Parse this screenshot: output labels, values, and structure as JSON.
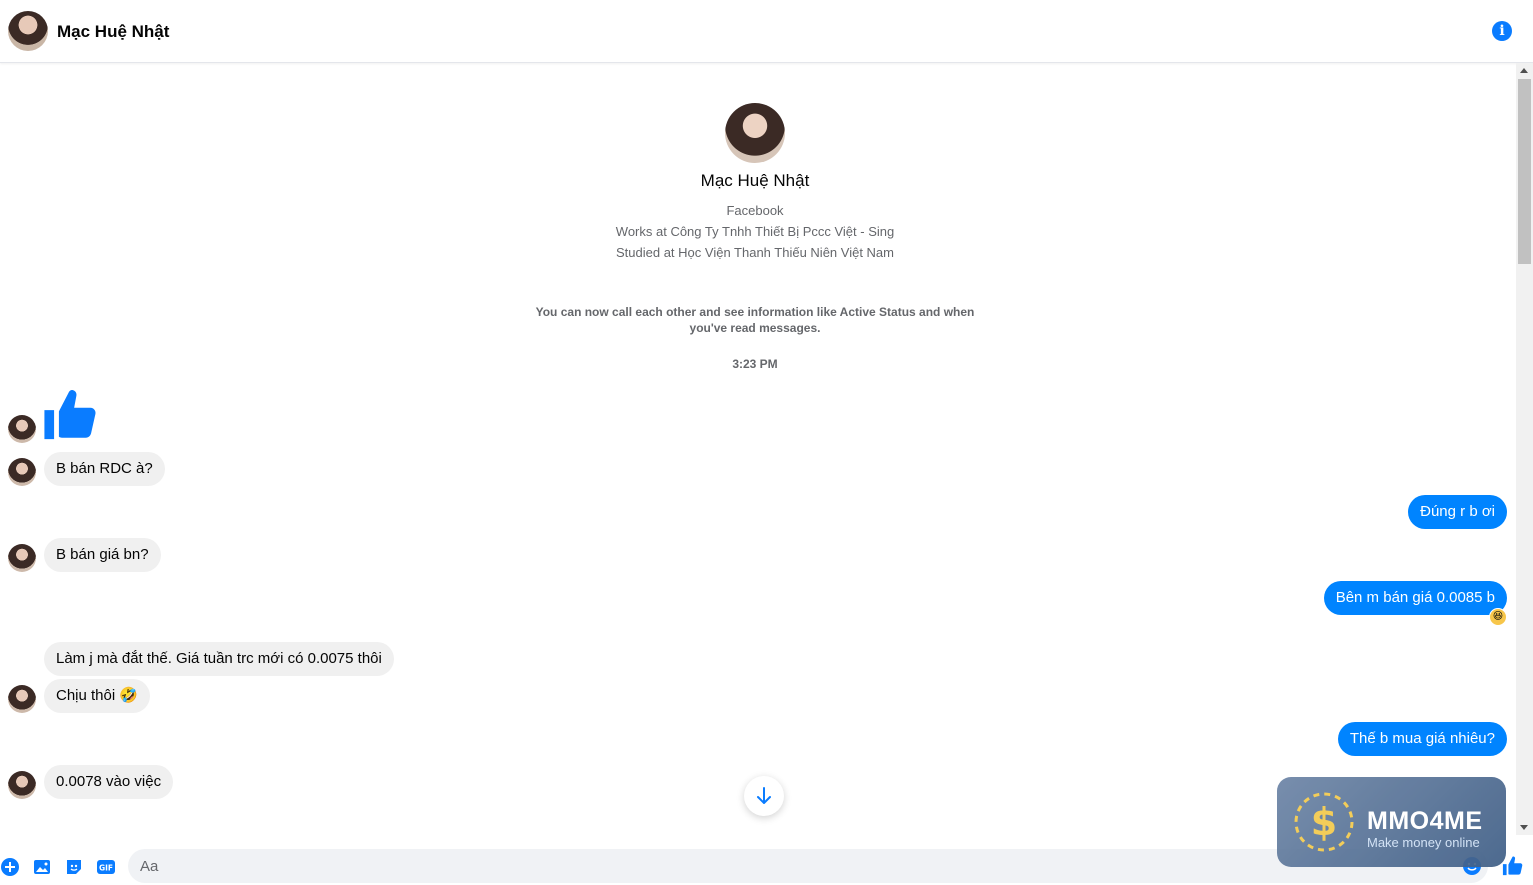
{
  "header": {
    "contact_name": "Mạc Huệ Nhật"
  },
  "profile": {
    "name": "Mạc Huệ Nhật",
    "platform": "Facebook",
    "work": "Works at Công Ty Tnhh Thiết Bị Pccc Việt - Sing",
    "education": "Studied at Học Viện Thanh Thiếu Niên Việt Nam"
  },
  "notice": "You can now call each other and see information like Active Status and when you've read messages.",
  "timestamp": "3:23 PM",
  "messages": [
    {
      "from": "them",
      "type": "like-sticker"
    },
    {
      "from": "them",
      "text": "B bán RDC à?"
    },
    {
      "from": "me",
      "text": "Đúng r b ơi"
    },
    {
      "from": "them",
      "text": "B bán giá bn?"
    },
    {
      "from": "me",
      "text": "Bên m bán giá 0.0085 b",
      "reaction": "laughing-emoji"
    },
    {
      "from": "them",
      "text": "Làm j mà đắt thế. Giá tuần trc mới có 0.0075 thôi"
    },
    {
      "from": "them",
      "text": "Chịu thôi 🤣"
    },
    {
      "from": "me",
      "text": "Thế b mua giá nhiêu?"
    },
    {
      "from": "them",
      "text": "0.0078 vào việc"
    }
  ],
  "composer": {
    "placeholder": "Aa"
  },
  "watermark": {
    "brand": "MMO4ME",
    "tagline": "Make money online"
  },
  "colors": {
    "accent": "#0084ff",
    "incoming_bubble": "#f0f0f0",
    "outgoing_text": "#ffffff"
  },
  "icons": [
    "info-icon",
    "like-icon",
    "plus-icon",
    "photo-icon",
    "sticker-icon",
    "gif-icon",
    "emoji-icon",
    "arrow-down-icon"
  ]
}
